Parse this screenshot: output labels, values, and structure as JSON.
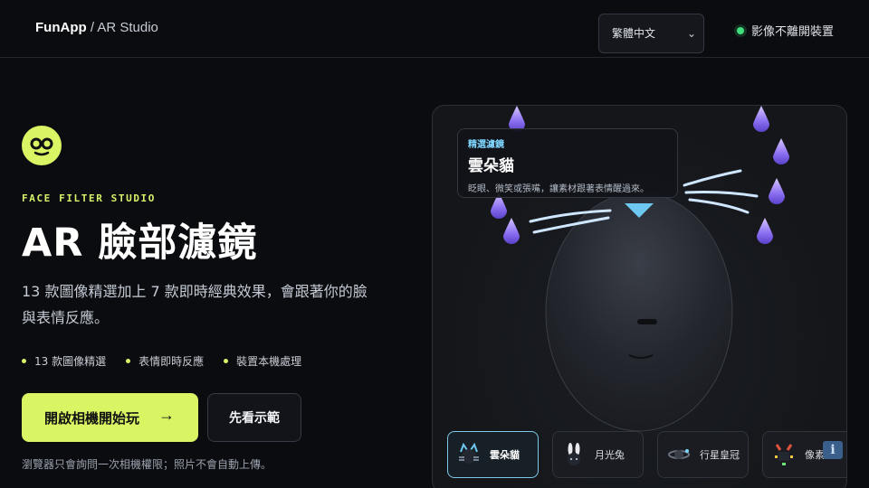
{
  "header": {
    "brand": "FunApp",
    "separator": "/",
    "subtitle": "AR Studio",
    "language_select": {
      "selected": "繁體中文",
      "icon": "chevron-down-icon"
    },
    "privacy_note": "影像不離開裝置",
    "privacy_status_color": "#3fe07b"
  },
  "hero": {
    "logo_icon": "glasses-face-icon",
    "eyebrow": "FACE FILTER STUDIO",
    "title": "AR 臉部濾鏡",
    "description": "13 款圖像精選加上 7 款即時經典效果，會跟著你的臉與表情反應。",
    "bullets": [
      "13 款圖像精選",
      "表情即時反應",
      "裝置本機處理"
    ],
    "primary_button": "開啟相機開始玩",
    "primary_icon": "arrow-right-icon",
    "secondary_button": "先看示範",
    "footnote": "瀏覽器只會詢問一次相機權限；照片不會自動上傳。"
  },
  "stage": {
    "card": {
      "tag": "精選濾鏡",
      "name": "雲朵貓",
      "hint": "眨眼、微笑或張嘴，讓素材跟著表情醒過來。"
    },
    "filters": [
      {
        "label": "雲朵貓",
        "icon": "cloud-cat-icon",
        "active": true
      },
      {
        "label": "月光兔",
        "icon": "moon-rabbit-icon",
        "active": false
      },
      {
        "label": "行星皇冠",
        "icon": "planet-crown-icon",
        "active": false
      },
      {
        "label": "像素鬼",
        "icon": "pixel-ghost-icon",
        "active": false
      }
    ],
    "info_label": "i"
  },
  "colors": {
    "accent": "#d9f564",
    "background": "#0b0c0f",
    "highlight": "#7fd7ff"
  }
}
